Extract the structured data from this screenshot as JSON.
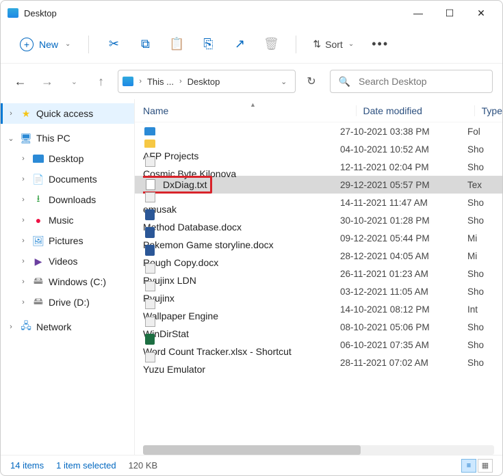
{
  "window": {
    "title": "Desktop"
  },
  "toolbar": {
    "new_label": "New",
    "sort_label": "Sort"
  },
  "address": {
    "seg1": "This ...",
    "seg2": "Desktop"
  },
  "search": {
    "placeholder": "Search Desktop"
  },
  "sidebar": {
    "quick_access": "Quick access",
    "this_pc": "This PC",
    "desktop": "Desktop",
    "documents": "Documents",
    "downloads": "Downloads",
    "music": "Music",
    "pictures": "Pictures",
    "videos": "Videos",
    "windows_c": "Windows (C:)",
    "drive_d": "Drive (D:)",
    "network": "Network"
  },
  "columns": {
    "name": "Name",
    "date": "Date modified",
    "type": "Type"
  },
  "files": [
    {
      "icon": "desktop",
      "name": "",
      "date": "27-10-2021 03:38 PM",
      "type": "Fol"
    },
    {
      "icon": "folder",
      "name": "AFP Projects",
      "date": "04-10-2021 10:52 AM",
      "type": "Sho"
    },
    {
      "icon": "app",
      "name": "Cosmic Byte Kilonova",
      "date": "12-11-2021 02:04 PM",
      "type": "Sho"
    },
    {
      "icon": "txt",
      "name": "DxDiag.txt",
      "date": "29-12-2021 05:57 PM",
      "type": "Tex",
      "selected": true,
      "highlight": true
    },
    {
      "icon": "app",
      "name": "emusak",
      "date": "14-11-2021 11:47 AM",
      "type": "Sho"
    },
    {
      "icon": "word",
      "name": "Method Database.docx",
      "date": "30-10-2021 01:28 PM",
      "type": "Sho"
    },
    {
      "icon": "word",
      "name": "Pokemon Game storyline.docx",
      "date": "09-12-2021 05:44 PM",
      "type": "Mi"
    },
    {
      "icon": "word",
      "name": "Rough Copy.docx",
      "date": "28-12-2021 04:05 AM",
      "type": "Mi"
    },
    {
      "icon": "app",
      "name": "Ryujinx LDN",
      "date": "26-11-2021 01:23 AM",
      "type": "Sho"
    },
    {
      "icon": "app",
      "name": "Ryujinx",
      "date": "03-12-2021 11:05 AM",
      "type": "Sho"
    },
    {
      "icon": "app",
      "name": "Wallpaper Engine",
      "date": "14-10-2021 08:12 PM",
      "type": "Int"
    },
    {
      "icon": "app",
      "name": "WinDirStat",
      "date": "08-10-2021 05:06 PM",
      "type": "Sho"
    },
    {
      "icon": "xlsx",
      "name": "Word Count Tracker.xlsx - Shortcut",
      "date": "06-10-2021 07:35 AM",
      "type": "Sho"
    },
    {
      "icon": "app",
      "name": "Yuzu Emulator",
      "date": "28-11-2021 07:02 AM",
      "type": "Sho"
    }
  ],
  "status": {
    "count": "14 items",
    "selected": "1 item selected",
    "size": "120 KB"
  }
}
